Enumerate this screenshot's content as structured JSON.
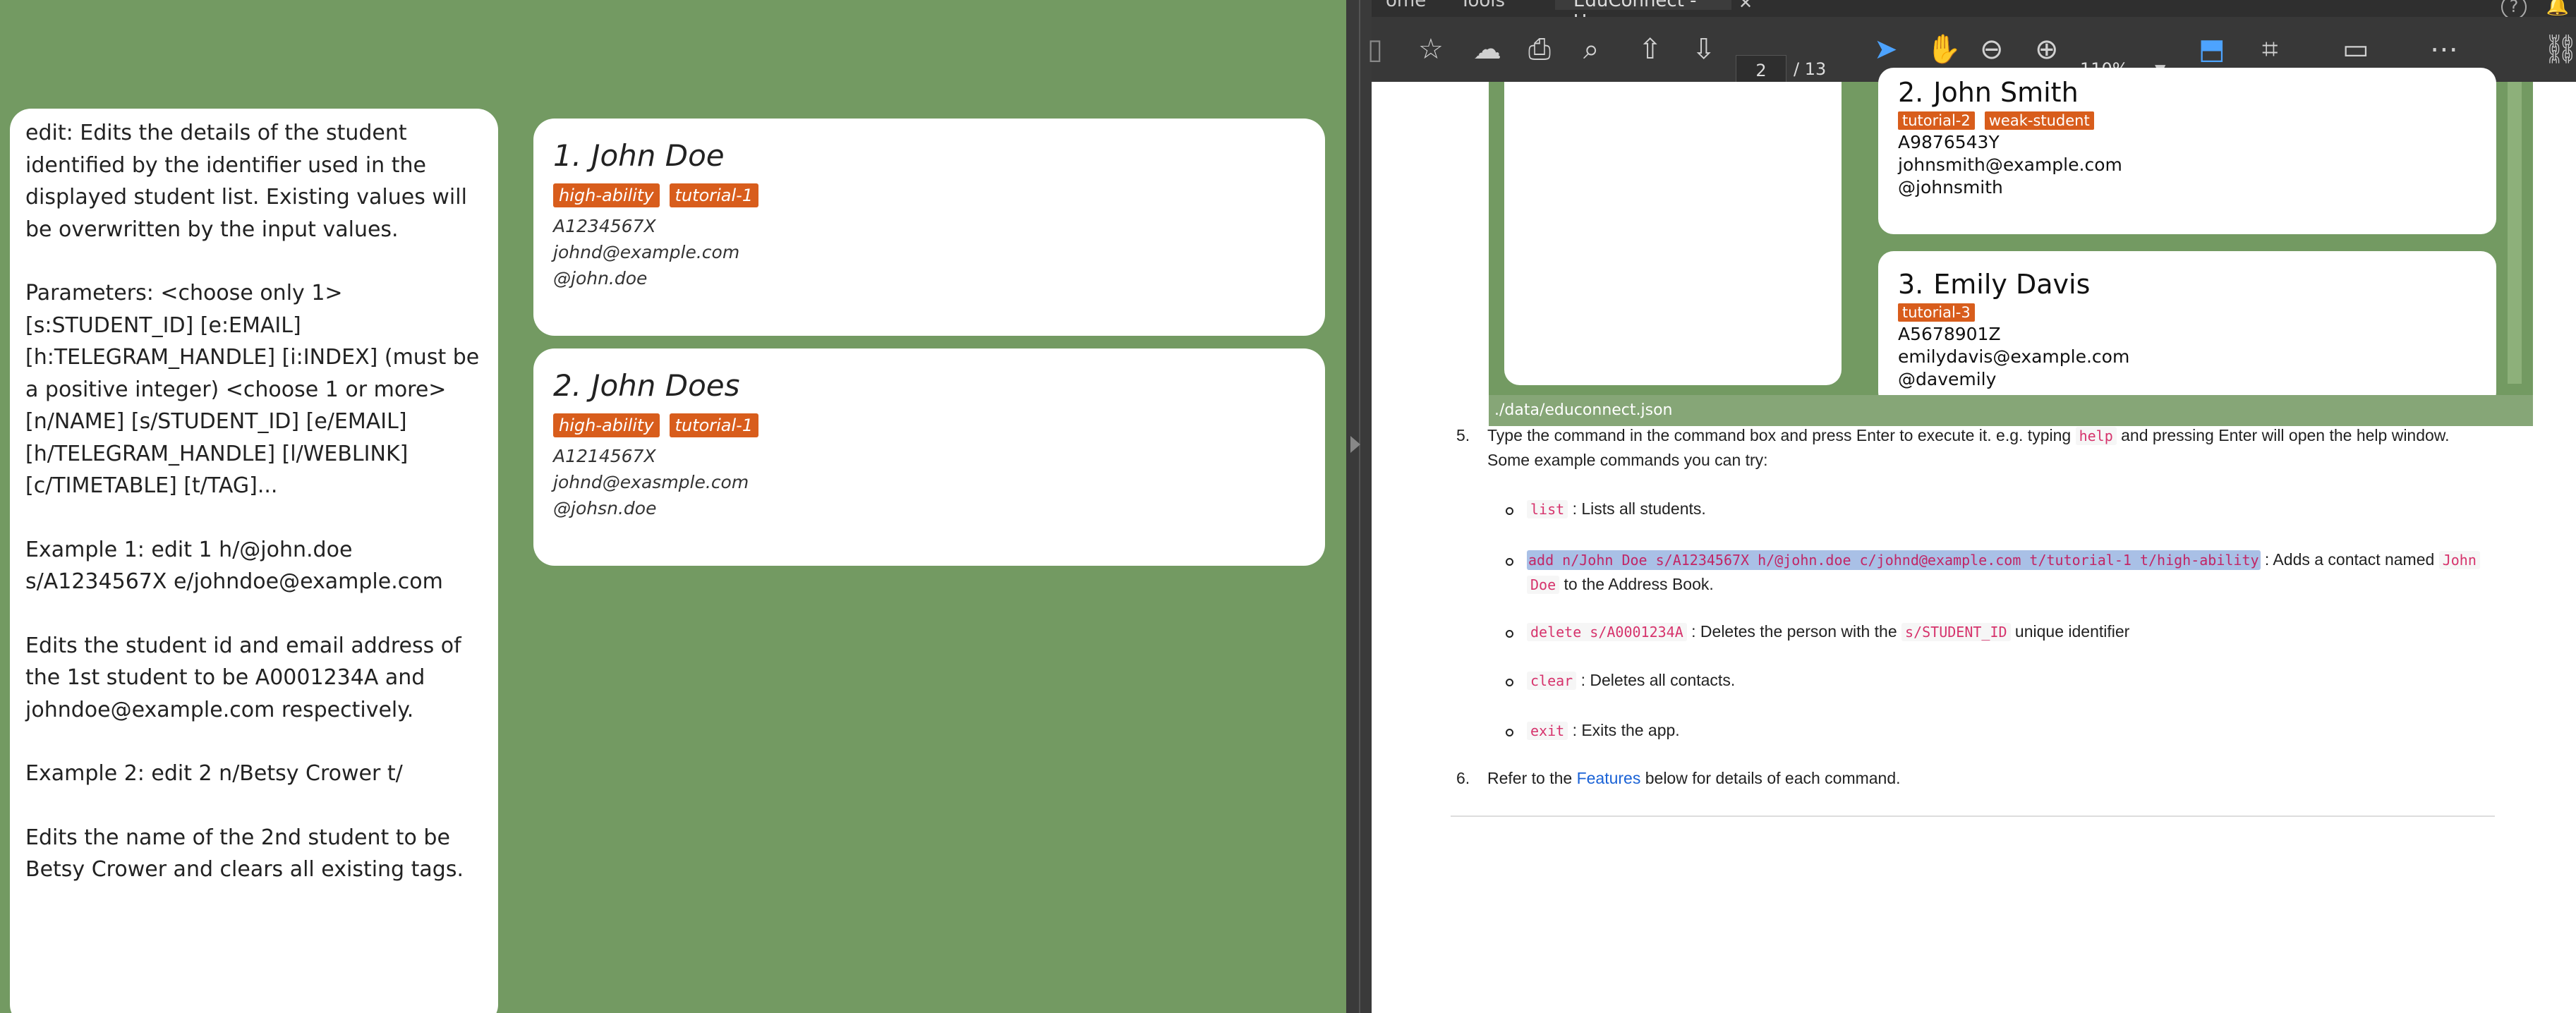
{
  "left_app": {
    "result": [
      "edit: Edits the details of the student identified by the identifier used in the displayed student list. Existing values will be overwritten by the input values.",
      "Parameters: <choose only 1>[s:STUDENT_ID] [e:EMAIL] [h:TELEGRAM_HANDLE] [i:INDEX] (must be a positive integer) <choose 1 or more> [n/NAME] [s/STUDENT_ID] [e/EMAIL] [h/TELEGRAM_HANDLE] [l/WEBLINK] [c/TIMETABLE] [t/TAG]...",
      "Example 1: edit 1 h/@john.doe s/A1234567X e/johndoe@example.com",
      "Edits the student id and email address of the 1st student to be A0001234A and johndoe@example.com respectively.",
      "Example 2: edit 2 n/Betsy Crower t/",
      "Edits the name of the 2nd student to be Betsy Crower and clears all existing tags."
    ],
    "students": [
      {
        "index": "1.",
        "name": "John Doe",
        "tags": [
          "high-ability",
          "tutorial-1"
        ],
        "id": "A1234567X",
        "email": "johnd@example.com",
        "telegram": "@john.doe"
      },
      {
        "index": "2.",
        "name": "John Does",
        "tags": [
          "high-ability",
          "tutorial-1"
        ],
        "id": "A1214567X",
        "email": "johnd@exasmple.com",
        "telegram": "@johsn.doe"
      }
    ],
    "colors": {
      "background": "#739a62",
      "tag": "#d85d1c"
    }
  },
  "pdf_viewer": {
    "tabs": {
      "home": "ome",
      "tools": "Tools",
      "document": "EduConnect - User ..."
    },
    "toolbar": {
      "page_current": "2",
      "page_total": "/ 13",
      "zoom": "110%"
    },
    "embedded": {
      "cards": [
        {
          "index": "2.",
          "name": "John Smith",
          "tags": [
            "tutorial-2",
            "weak-student"
          ],
          "id": "A9876543Y",
          "email": "johnsmith@example.com",
          "telegram": "@johnsmith"
        },
        {
          "index": "3.",
          "name": "Emily Davis",
          "tags": [
            "tutorial-3"
          ],
          "id": "A5678901Z",
          "email": "emilydavis@example.com",
          "telegram": "@davemily"
        }
      ],
      "status": "./data/educonnect.json"
    },
    "content": {
      "step5_num": "5.",
      "step5_a": "Type the command in the command box and press Enter to execute it. e.g. typing",
      "step5_help": "help",
      "step5_b": "and pressing Enter will open the help window.",
      "step5_c": "Some example commands you can try:",
      "items": [
        {
          "code": "list",
          "text": ": Lists all students."
        },
        {
          "code": "add n/John Doe s/A1234567X h/@john.doe c/johnd@example.com t/tutorial-1 t/high-ability",
          "text": ": Adds a contact named",
          "code2": "John",
          "code3": "Doe",
          "text2": "to the Address Book."
        },
        {
          "code": "delete s/A0001234A",
          "text": ": Deletes the person with the",
          "code2": "s/STUDENT_ID",
          "text2": "unique identifier"
        },
        {
          "code": "clear",
          "text": ": Deletes all contacts."
        },
        {
          "code": "exit",
          "text": ": Exits the app."
        }
      ],
      "step6_num": "6.",
      "step6_a": "Refer to the",
      "step6_link": "Features",
      "step6_b": "below for details of each command."
    }
  }
}
